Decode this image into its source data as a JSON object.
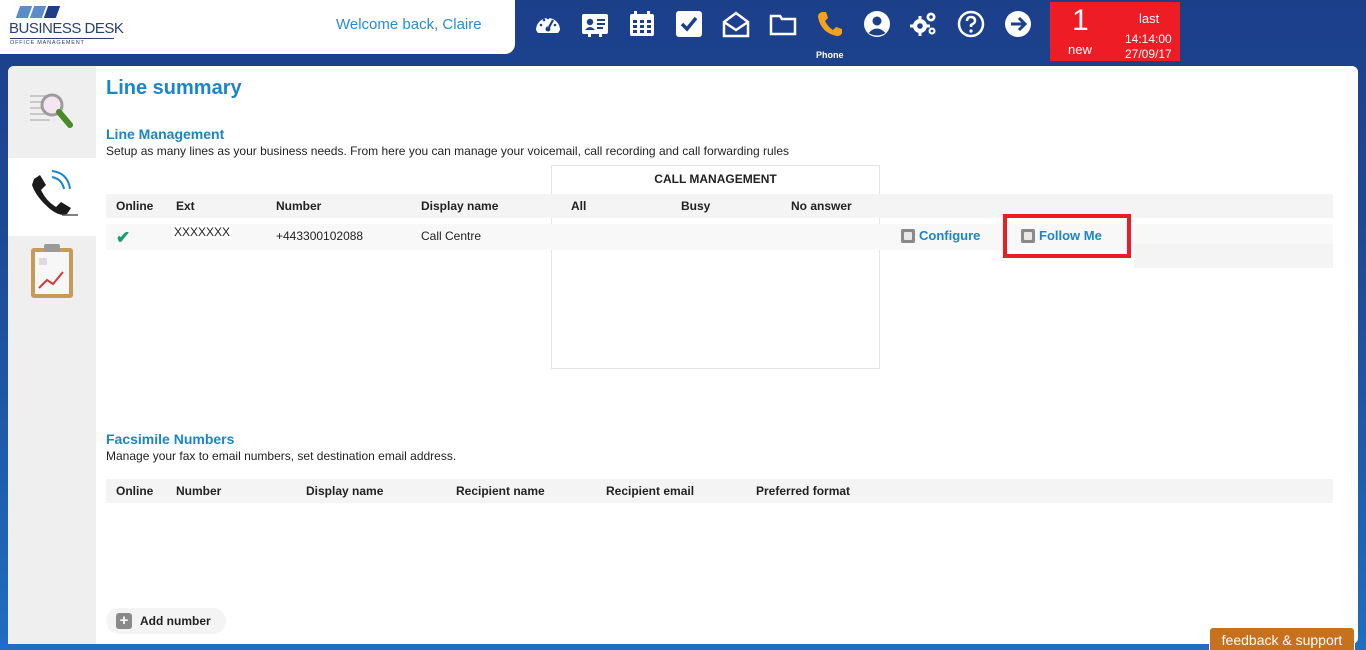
{
  "header": {
    "logo_title": "BUSINESS DESK",
    "logo_subtitle": "OFFICE MANAGEMENT",
    "welcome": "Welcome back, Claire",
    "nav_icons": [
      "dashboard-icon",
      "contacts-icon",
      "calendar-icon",
      "tasks-icon",
      "mail-icon",
      "folder-icon",
      "phone-icon",
      "user-icon",
      "settings-icon",
      "help-icon",
      "logout-icon"
    ],
    "active_label": "Phone",
    "active_color": "#f7a21b"
  },
  "notification": {
    "count": "1",
    "count_label": "new",
    "last_label": "last",
    "time": "14:14:00",
    "date": "27/09/17",
    "color": "#ee1c25"
  },
  "sidebar": {
    "items": [
      "search-icon",
      "phone-icon",
      "report-icon"
    ],
    "active": "phone-icon"
  },
  "page_title": "Line summary",
  "line_management": {
    "title": "Line Management",
    "description": "Setup as many lines as your business needs. From here you can manage your voicemail, call recording and call forwarding rules",
    "call_management_title": "CALL MANAGEMENT",
    "columns": [
      "Online",
      "Ext",
      "Number",
      "Display name",
      "All",
      "Busy",
      "No answer"
    ],
    "rows": [
      {
        "online": true,
        "ext": "XXXXXXX",
        "number": "+443300102088",
        "display_name": "Call Centre",
        "configure_label": "Configure",
        "follow_me_label": "Follow Me"
      }
    ]
  },
  "fax": {
    "title": "Facsimile Numbers",
    "description": "Manage your fax to email numbers, set destination email address.",
    "columns": [
      "Online",
      "Number",
      "Display name",
      "Recipient name",
      "Recipient email",
      "Preferred format"
    ]
  },
  "add_number_label": "Add number",
  "feedback_label": "feedback & support",
  "highlight_color": "#e81d25",
  "accent_color": "#1b86c7"
}
